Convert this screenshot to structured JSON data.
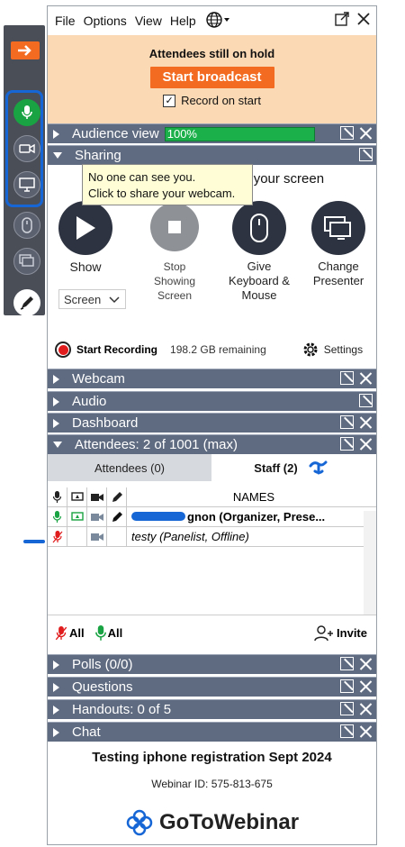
{
  "menu": {
    "file": "File",
    "options": "Options",
    "view": "View",
    "help": "Help"
  },
  "hold": {
    "title": "Attendees still on hold",
    "broadcast_label": "Start broadcast",
    "record_label": "Record on start",
    "record_checked": true
  },
  "sections": {
    "audience": "Audience view",
    "audience_progress": "100%",
    "audience_progress_value": 100,
    "sharing": "Sharing",
    "webcam": "Webcam",
    "audio": "Audio",
    "dashboard": "Dashboard",
    "attendees": "Attendees:  2 of 1001 (max)",
    "polls": "Polls (0/0)",
    "questions": "Questions",
    "handouts": "Handouts: 0 of 5",
    "chat": "Chat"
  },
  "sharing": {
    "status_text": "ne sees your screen",
    "tooltip_line1": "No one can see you.",
    "tooltip_line2": "Click to share your webcam.",
    "show_label": "Show",
    "show_select": "Screen",
    "stop_label": "Stop Showing Screen",
    "give_label": "Give Keyboard & Mouse",
    "change_label": "Change Presenter",
    "start_recording": "Start Recording",
    "remaining": "198.2 GB remaining",
    "settings": "Settings"
  },
  "attendees": {
    "tab_attendees": "Attendees (0)",
    "tab_staff": "Staff (2)",
    "names_header": "NAMES",
    "rows": [
      {
        "name": "gnon (Organizer, Prese...",
        "mic": "on"
      },
      {
        "name": "testy (Panelist, Offline)",
        "mic": "off"
      }
    ],
    "all_label": "All",
    "all_label2": "All",
    "invite_label": "Invite"
  },
  "footer": {
    "title": "Testing iphone registration Sept 2024",
    "webinar_id": "Webinar ID: 575-813-675",
    "logo_text": "GoToWebinar"
  },
  "colors": {
    "accent": "#f26b21",
    "header": "#5f6b80",
    "green": "#19a342",
    "red": "#e11c1c",
    "highlight_blue": "#1766d6"
  }
}
